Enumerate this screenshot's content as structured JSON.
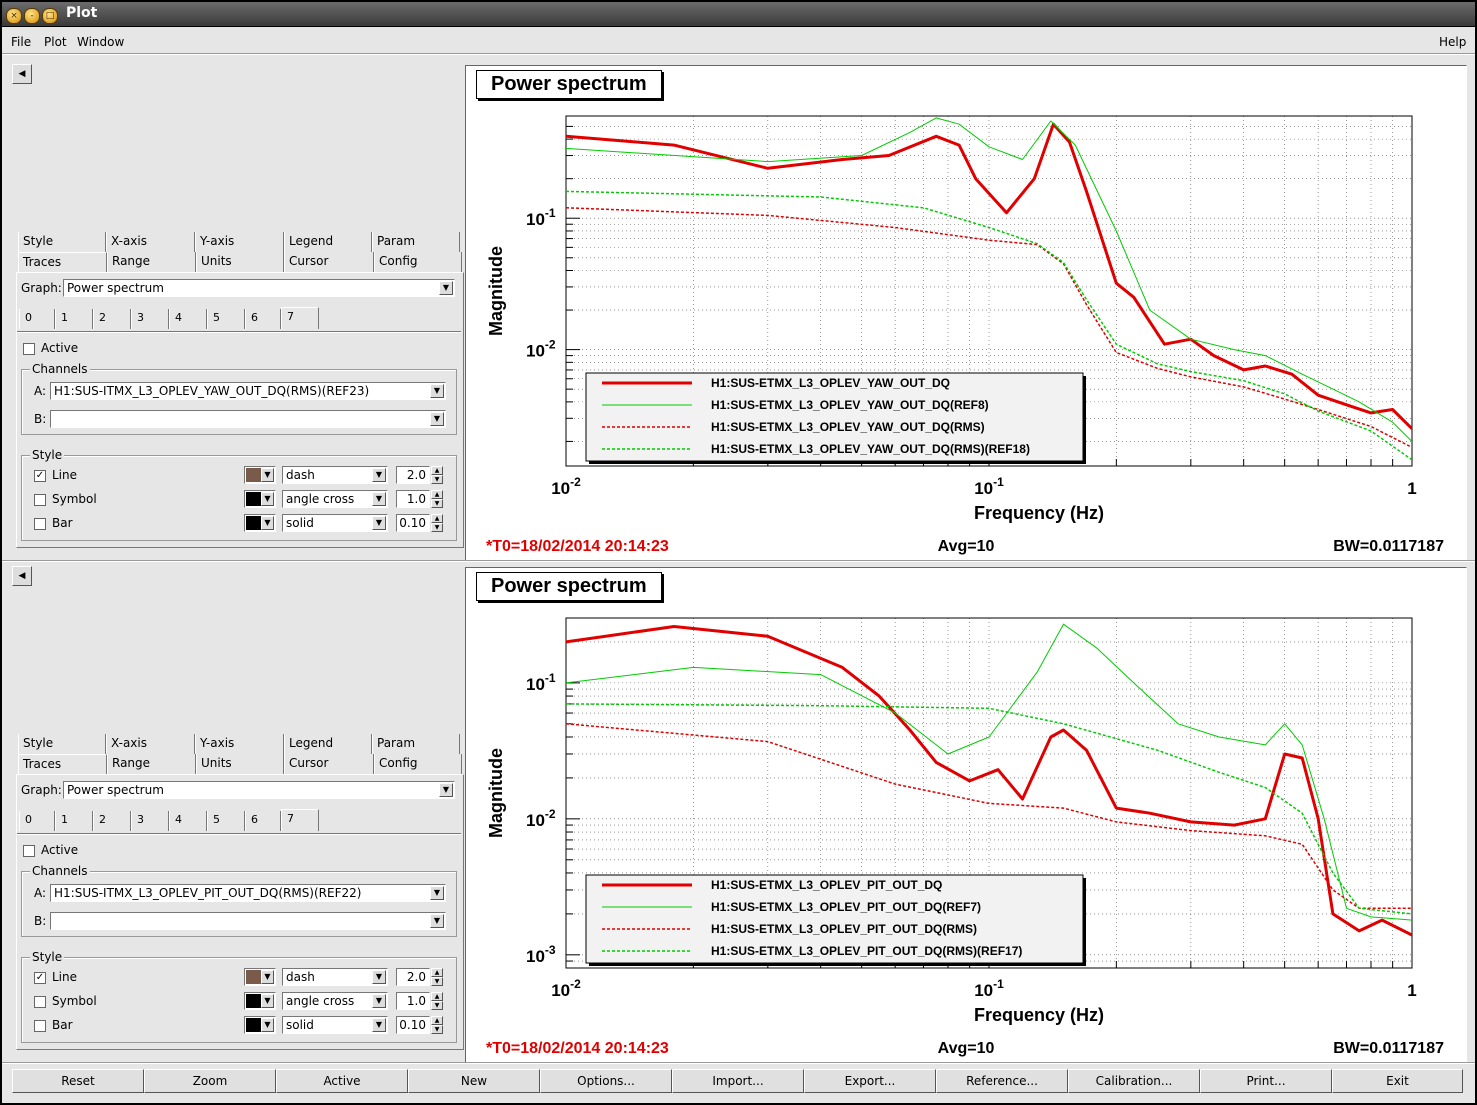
{
  "window": {
    "title": "Plot"
  },
  "menu": {
    "file": "File",
    "plot": "Plot",
    "window": "Window",
    "help": "Help"
  },
  "panels": [
    {
      "tabs_top": [
        "Style",
        "X-axis",
        "Y-axis",
        "Legend",
        "Param"
      ],
      "tabs_bottom": [
        "Traces",
        "Range",
        "Units",
        "Cursor",
        "Config"
      ],
      "graph_label": "Graph:",
      "graph_value": "Power spectrum",
      "trace_tabs": [
        "0",
        "1",
        "2",
        "3",
        "4",
        "5",
        "6",
        "7"
      ],
      "active_label": "Active",
      "channels_title": "Channels",
      "channel_a_label": "A:",
      "channel_a": "H1:SUS-ITMX_L3_OPLEV_YAW_OUT_DQ(RMS)(REF23)",
      "channel_b_label": "B:",
      "channel_b": "",
      "style_title": "Style",
      "line_label": "Line",
      "symbol_label": "Symbol",
      "bar_label": "Bar",
      "line_style": "dash",
      "symbol_style": "angle cross",
      "bar_style": "solid",
      "line_width": "2.0",
      "symbol_size": "1.0",
      "bar_width": "0.10",
      "line_color": "#7a5a4a",
      "symbol_color": "#000000",
      "bar_color": "#000000",
      "plot": {
        "title": "Power spectrum",
        "xlabel": "Frequency (Hz)",
        "ylabel": "Magnitude",
        "t0": "*T0=18/02/2014 20:14:23",
        "avg": "Avg=10",
        "bw": "BW=0.0117187",
        "x_ticks": [
          {
            "base": "10",
            "exp": "-2"
          },
          {
            "base": "10",
            "exp": "-1"
          },
          {
            "base": "1",
            "exp": ""
          }
        ],
        "y_ticks": [
          {
            "base": "10",
            "exp": "-1"
          },
          {
            "base": "10",
            "exp": "-2"
          }
        ],
        "legend": [
          "H1:SUS-ETMX_L3_OPLEV_YAW_OUT_DQ",
          "H1:SUS-ETMX_L3_OPLEV_YAW_OUT_DQ(REF8)",
          "H1:SUS-ETMX_L3_OPLEV_YAW_OUT_DQ(RMS)",
          "H1:SUS-ETMX_L3_OPLEV_YAW_OUT_DQ(RMS)(REF18)"
        ]
      }
    },
    {
      "tabs_top": [
        "Style",
        "X-axis",
        "Y-axis",
        "Legend",
        "Param"
      ],
      "tabs_bottom": [
        "Traces",
        "Range",
        "Units",
        "Cursor",
        "Config"
      ],
      "graph_label": "Graph:",
      "graph_value": "Power spectrum",
      "trace_tabs": [
        "0",
        "1",
        "2",
        "3",
        "4",
        "5",
        "6",
        "7"
      ],
      "active_label": "Active",
      "channels_title": "Channels",
      "channel_a_label": "A:",
      "channel_a": "H1:SUS-ITMX_L3_OPLEV_PIT_OUT_DQ(RMS)(REF22)",
      "channel_b_label": "B:",
      "channel_b": "",
      "style_title": "Style",
      "line_label": "Line",
      "symbol_label": "Symbol",
      "bar_label": "Bar",
      "line_style": "dash",
      "symbol_style": "angle cross",
      "bar_style": "solid",
      "line_width": "2.0",
      "symbol_size": "1.0",
      "bar_width": "0.10",
      "line_color": "#7a5a4a",
      "symbol_color": "#000000",
      "bar_color": "#000000",
      "plot": {
        "title": "Power spectrum",
        "xlabel": "Frequency (Hz)",
        "ylabel": "Magnitude",
        "t0": "*T0=18/02/2014 20:14:23",
        "avg": "Avg=10",
        "bw": "BW=0.0117187",
        "x_ticks": [
          {
            "base": "10",
            "exp": "-2"
          },
          {
            "base": "10",
            "exp": "-1"
          },
          {
            "base": "1",
            "exp": ""
          }
        ],
        "y_ticks": [
          {
            "base": "10",
            "exp": "-1"
          },
          {
            "base": "10",
            "exp": "-2"
          },
          {
            "base": "10",
            "exp": "-3"
          }
        ],
        "legend": [
          "H1:SUS-ETMX_L3_OPLEV_PIT_OUT_DQ",
          "H1:SUS-ETMX_L3_OPLEV_PIT_OUT_DQ(REF7)",
          "H1:SUS-ETMX_L3_OPLEV_PIT_OUT_DQ(RMS)",
          "H1:SUS-ETMX_L3_OPLEV_PIT_OUT_DQ(RMS)(REF17)"
        ]
      }
    }
  ],
  "buttons": [
    "Reset",
    "Zoom",
    "Active",
    "New",
    "Options...",
    "Import...",
    "Export...",
    "Reference...",
    "Calibration...",
    "Print...",
    "Exit"
  ],
  "chart_data": [
    {
      "type": "line",
      "title": "Power spectrum",
      "xlabel": "Frequency (Hz)",
      "ylabel": "Magnitude",
      "xscale": "log",
      "yscale": "log",
      "xlim": [
        0.01,
        1
      ],
      "ylim": [
        0.0013,
        0.6
      ],
      "grid": true,
      "legend_position": "bottom-left",
      "series": [
        {
          "name": "H1:SUS-ETMX_L3_OPLEV_YAW_OUT_DQ",
          "color": "#e00000",
          "dash": "solid",
          "width": 3,
          "points": [
            [
              0.01,
              0.42
            ],
            [
              0.018,
              0.36
            ],
            [
              0.03,
              0.24
            ],
            [
              0.045,
              0.28
            ],
            [
              0.058,
              0.3
            ],
            [
              0.075,
              0.42
            ],
            [
              0.085,
              0.36
            ],
            [
              0.093,
              0.2
            ],
            [
              0.11,
              0.11
            ],
            [
              0.128,
              0.2
            ],
            [
              0.142,
              0.52
            ],
            [
              0.155,
              0.38
            ],
            [
              0.17,
              0.16
            ],
            [
              0.2,
              0.032
            ],
            [
              0.22,
              0.025
            ],
            [
              0.26,
              0.011
            ],
            [
              0.3,
              0.012
            ],
            [
              0.34,
              0.009
            ],
            [
              0.4,
              0.007
            ],
            [
              0.45,
              0.0075
            ],
            [
              0.52,
              0.0065
            ],
            [
              0.6,
              0.0045
            ],
            [
              0.7,
              0.0038
            ],
            [
              0.8,
              0.0033
            ],
            [
              0.9,
              0.0035
            ],
            [
              1.0,
              0.0025
            ]
          ]
        },
        {
          "name": "H1:SUS-ETMX_L3_OPLEV_YAW_OUT_DQ(REF8)",
          "color": "#00cc00",
          "dash": "solid",
          "width": 1,
          "points": [
            [
              0.01,
              0.34
            ],
            [
              0.03,
              0.27
            ],
            [
              0.05,
              0.3
            ],
            [
              0.065,
              0.45
            ],
            [
              0.075,
              0.58
            ],
            [
              0.085,
              0.52
            ],
            [
              0.1,
              0.35
            ],
            [
              0.12,
              0.28
            ],
            [
              0.14,
              0.55
            ],
            [
              0.16,
              0.36
            ],
            [
              0.2,
              0.08
            ],
            [
              0.24,
              0.02
            ],
            [
              0.3,
              0.012
            ],
            [
              0.38,
              0.01
            ],
            [
              0.45,
              0.009
            ],
            [
              0.55,
              0.0065
            ],
            [
              0.65,
              0.005
            ],
            [
              0.75,
              0.004
            ],
            [
              0.9,
              0.0028
            ],
            [
              1.0,
              0.002
            ]
          ]
        },
        {
          "name": "H1:SUS-ETMX_L3_OPLEV_YAW_OUT_DQ(RMS)",
          "color": "#e00000",
          "dash": "dotted",
          "width": 1.5,
          "points": [
            [
              0.01,
              0.12
            ],
            [
              0.03,
              0.105
            ],
            [
              0.06,
              0.085
            ],
            [
              0.1,
              0.068
            ],
            [
              0.13,
              0.063
            ],
            [
              0.15,
              0.045
            ],
            [
              0.17,
              0.022
            ],
            [
              0.2,
              0.0095
            ],
            [
              0.25,
              0.0072
            ],
            [
              0.3,
              0.0062
            ],
            [
              0.4,
              0.0052
            ],
            [
              0.5,
              0.0042
            ],
            [
              0.6,
              0.0035
            ],
            [
              0.8,
              0.0026
            ],
            [
              1.0,
              0.0018
            ]
          ]
        },
        {
          "name": "H1:SUS-ETMX_L3_OPLEV_YAW_OUT_DQ(RMS)(REF18)",
          "color": "#00cc00",
          "dash": "dotted",
          "width": 1.5,
          "points": [
            [
              0.01,
              0.16
            ],
            [
              0.04,
              0.145
            ],
            [
              0.07,
              0.12
            ],
            [
              0.1,
              0.085
            ],
            [
              0.13,
              0.064
            ],
            [
              0.15,
              0.046
            ],
            [
              0.17,
              0.024
            ],
            [
              0.2,
              0.011
            ],
            [
              0.25,
              0.0078
            ],
            [
              0.3,
              0.0068
            ],
            [
              0.4,
              0.0058
            ],
            [
              0.5,
              0.0046
            ],
            [
              0.6,
              0.0034
            ],
            [
              0.8,
              0.0024
            ],
            [
              1.0,
              0.00145
            ]
          ]
        }
      ]
    },
    {
      "type": "line",
      "title": "Power spectrum",
      "xlabel": "Frequency (Hz)",
      "ylabel": "Magnitude",
      "xscale": "log",
      "yscale": "log",
      "xlim": [
        0.01,
        1
      ],
      "ylim": [
        0.0008,
        0.3
      ],
      "grid": true,
      "legend_position": "bottom-left",
      "series": [
        {
          "name": "H1:SUS-ETMX_L3_OPLEV_PIT_OUT_DQ",
          "color": "#e00000",
          "dash": "solid",
          "width": 3,
          "points": [
            [
              0.01,
              0.2
            ],
            [
              0.018,
              0.26
            ],
            [
              0.03,
              0.22
            ],
            [
              0.045,
              0.13
            ],
            [
              0.055,
              0.08
            ],
            [
              0.065,
              0.045
            ],
            [
              0.075,
              0.026
            ],
            [
              0.09,
              0.019
            ],
            [
              0.105,
              0.023
            ],
            [
              0.12,
              0.014
            ],
            [
              0.14,
              0.04
            ],
            [
              0.15,
              0.045
            ],
            [
              0.17,
              0.032
            ],
            [
              0.2,
              0.012
            ],
            [
              0.24,
              0.011
            ],
            [
              0.3,
              0.0095
            ],
            [
              0.38,
              0.009
            ],
            [
              0.45,
              0.01
            ],
            [
              0.5,
              0.03
            ],
            [
              0.55,
              0.028
            ],
            [
              0.6,
              0.01
            ],
            [
              0.65,
              0.002
            ],
            [
              0.75,
              0.0015
            ],
            [
              0.85,
              0.0018
            ],
            [
              1.0,
              0.0014
            ]
          ]
        },
        {
          "name": "H1:SUS-ETMX_L3_OPLEV_PIT_OUT_DQ(REF7)",
          "color": "#00cc00",
          "dash": "solid",
          "width": 1,
          "points": [
            [
              0.01,
              0.1
            ],
            [
              0.02,
              0.13
            ],
            [
              0.04,
              0.115
            ],
            [
              0.06,
              0.06
            ],
            [
              0.08,
              0.03
            ],
            [
              0.1,
              0.04
            ],
            [
              0.13,
              0.12
            ],
            [
              0.15,
              0.27
            ],
            [
              0.18,
              0.18
            ],
            [
              0.22,
              0.1
            ],
            [
              0.28,
              0.05
            ],
            [
              0.35,
              0.04
            ],
            [
              0.45,
              0.035
            ],
            [
              0.5,
              0.05
            ],
            [
              0.55,
              0.035
            ],
            [
              0.62,
              0.01
            ],
            [
              0.7,
              0.0022
            ],
            [
              0.8,
              0.0019
            ],
            [
              1.0,
              0.0018
            ]
          ]
        },
        {
          "name": "H1:SUS-ETMX_L3_OPLEV_PIT_OUT_DQ(RMS)",
          "color": "#e00000",
          "dash": "dotted",
          "width": 1.5,
          "points": [
            [
              0.01,
              0.05
            ],
            [
              0.03,
              0.037
            ],
            [
              0.06,
              0.018
            ],
            [
              0.1,
              0.013
            ],
            [
              0.15,
              0.012
            ],
            [
              0.2,
              0.0095
            ],
            [
              0.3,
              0.0082
            ],
            [
              0.45,
              0.0075
            ],
            [
              0.55,
              0.0065
            ],
            [
              0.65,
              0.003
            ],
            [
              0.75,
              0.0022
            ],
            [
              1.0,
              0.0022
            ]
          ]
        },
        {
          "name": "H1:SUS-ETMX_L3_OPLEV_PIT_OUT_DQ(RMS)(REF17)",
          "color": "#00cc00",
          "dash": "dotted",
          "width": 1.5,
          "points": [
            [
              0.01,
              0.07
            ],
            [
              0.04,
              0.068
            ],
            [
              0.1,
              0.065
            ],
            [
              0.15,
              0.05
            ],
            [
              0.25,
              0.032
            ],
            [
              0.35,
              0.022
            ],
            [
              0.45,
              0.017
            ],
            [
              0.55,
              0.011
            ],
            [
              0.65,
              0.004
            ],
            [
              0.75,
              0.0022
            ],
            [
              1.0,
              0.002
            ]
          ]
        }
      ]
    }
  ]
}
